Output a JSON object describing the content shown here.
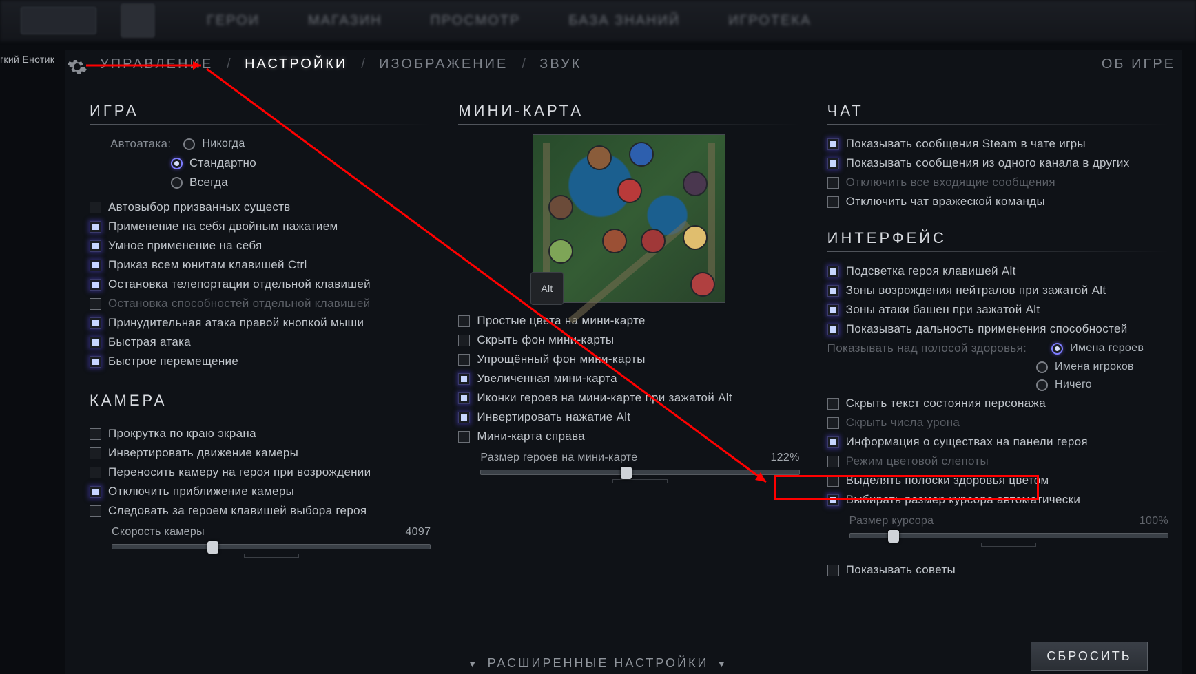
{
  "user_tag": "гкий Енотик",
  "tabs": {
    "controls": "УПРАВЛЕНИЕ",
    "settings": "НАСТРОЙКИ",
    "video": "ИЗОБРАЖЕНИЕ",
    "audio": "ЗВУК",
    "about": "ОБ ИГРЕ"
  },
  "advanced_label": "РАСШИРЕННЫЕ НАСТРОЙКИ",
  "reset_label": "СБРОСИТЬ",
  "minimap_key": "Alt",
  "game": {
    "title": "ИГРА",
    "autoattack_label": "Автоатака:",
    "autoattack": {
      "never": "Никогда",
      "standard": "Стандартно",
      "always": "Всегда"
    },
    "opts": {
      "auto_select": "Автовыбор призванных существ",
      "double_self": "Применение на себя двойным нажатием",
      "smart_self": "Умное применение на себя",
      "ctrl_all": "Приказ всем юнитам клавишей Ctrl",
      "tp_stop": "Остановка телепортации отдельной клавишей",
      "ability_stop": "Остановка способностей отдельной клавишей",
      "rmb_attack": "Принудительная атака правой кнопкой мыши",
      "quick_attack": "Быстрая атака",
      "quick_move": "Быстрое перемещение"
    }
  },
  "camera": {
    "title": "КАМЕРА",
    "edge_pan": "Прокрутка по краю экрана",
    "invert": "Инвертировать движение камеры",
    "respawn": "Переносить камеру на героя при возрождении",
    "disable_zoom": "Отключить приближение камеры",
    "follow": "Следовать за героем клавишей выбора героя",
    "speed_label": "Скорость камеры",
    "speed_value": "4097"
  },
  "minimap": {
    "title": "МИНИ-КАРТА",
    "simple_colors": "Простые цвета на мини-карте",
    "hide_bg": "Скрыть фон мини-карты",
    "simple_bg": "Упрощённый фон мини-карты",
    "large": "Увеличенная мини-карта",
    "alt_icons": "Иконки героев на мини-карте при зажатой Alt",
    "invert_alt": "Инвертировать нажатие Alt",
    "right": "Мини-карта справа",
    "hero_size_label": "Размер героев на мини-карте",
    "hero_size_value": "122%"
  },
  "chat": {
    "title": "ЧАТ",
    "steam": "Показывать сообщения Steam в чате игры",
    "channel": "Показывать сообщения из одного канала в других",
    "mute_all": "Отключить все входящие сообщения",
    "mute_enemy": "Отключить чат вражеской команды"
  },
  "iface": {
    "title": "ИНТЕРФЕЙС",
    "alt_hero": "Подсветка героя клавишей Alt",
    "neutral_spawn": "Зоны возрождения нейтралов при зажатой Alt",
    "tower_range": "Зоны атаки башен при зажатой Alt",
    "ability_range": "Показывать дальность применения способностей",
    "hpbar_label": "Показывать над полосой здоровья:",
    "hpbar": {
      "heroes": "Имена героев",
      "players": "Имена игроков",
      "none": "Ничего"
    },
    "hide_status": "Скрыть текст состояния персонажа",
    "hide_dmg": "Скрыть числа урона",
    "creature_panel": "Информация о существах на панели героя",
    "colorblind": "Режим цветовой слепоты",
    "color_hp": "Выделять полоски здоровья цветом",
    "auto_cursor": "Выбирать размер курсора автоматически",
    "cursor_size_label": "Размер курсора",
    "cursor_size_value": "100%",
    "show_tips": "Показывать советы"
  }
}
